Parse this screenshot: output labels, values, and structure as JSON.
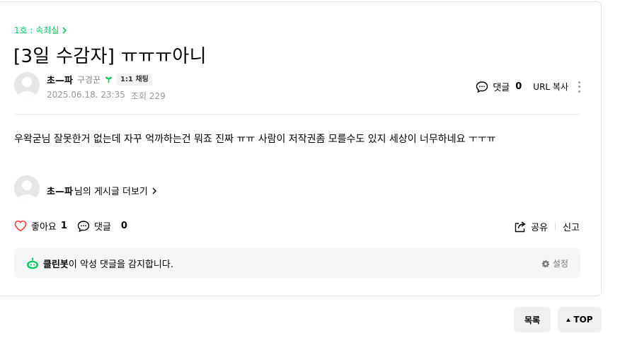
{
  "board": {
    "label": "1호 : 속죄실"
  },
  "post": {
    "title": "[3일 수감자] ㅠㅠㅠ아니",
    "body": "우왁굳님 잘못한거 없는데 자꾸 억까하는건 뭐죠 진짜 ㅠㅠ 사람이 저작권좀 모를수도 있지 세상이 너무하네요 ㅜㅜㅠ",
    "date": "2025.06.18. 23:35",
    "views_label": "조회 229"
  },
  "author": {
    "nickname": "초—파",
    "rank": "구경꾼",
    "chat_badge": "1:1 채팅"
  },
  "header_tools": {
    "comment_label": "댓글",
    "comment_count": "0",
    "url_copy": "URL 복사"
  },
  "more_posts": {
    "nickname": "초—파",
    "suffix": "님의 게시글 더보기"
  },
  "reactions": {
    "like_label": "좋아요",
    "like_count": "1",
    "comment_label": "댓글",
    "comment_count": "0"
  },
  "share": {
    "share_label": "공유",
    "report_label": "신고"
  },
  "cleanbot": {
    "name": "클린봇",
    "message": "이 악성 댓글을 감지합니다.",
    "settings_label": "설정"
  },
  "bottom_buttons": {
    "list_label": "목록",
    "top_label": "TOP"
  },
  "colors": {
    "accent_green": "#03c75a",
    "like_red": "#f53535",
    "muted_text": "#979797",
    "panel_bg": "#f5f6f8"
  },
  "icons": [
    "chevron-right-icon",
    "sprout-icon",
    "comment-icon",
    "more-vertical-icon",
    "heart-icon",
    "share-icon",
    "cleanbot-icon",
    "gear-icon",
    "triangle-up-icon",
    "default-avatar-icon"
  ]
}
